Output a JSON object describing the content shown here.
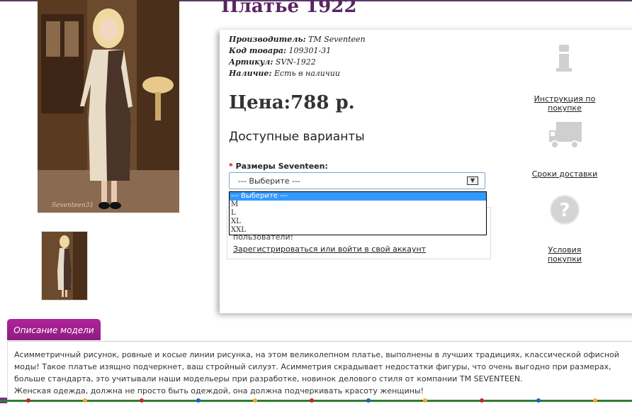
{
  "product": {
    "title": "Платье 1922",
    "meta": [
      {
        "key": "Производитель:",
        "value": " TM Seventeen"
      },
      {
        "key": "Код товара:",
        "value": " 109301-31"
      },
      {
        "key": "Артикул:",
        "value": " SVN-1922"
      },
      {
        "key": "Наличие:",
        "value": " Есть в наличии"
      }
    ],
    "price": "Цена:788 р."
  },
  "options": {
    "heading": "Доступные варианты",
    "size_label": "Размеры Seventeen:",
    "required_mark": "*",
    "selected": "--- Выберите ---",
    "items": [
      "--- Выберите ---",
      "M",
      "L",
      "XL",
      "XXL"
    ]
  },
  "login": {
    "text": "пользователи!",
    "link": "Зарегистрироваться или войти в свой аккаунт"
  },
  "side": {
    "instruction": "Инструкция по покупке",
    "delivery": "Сроки доставки",
    "conditions": "Условия покупки"
  },
  "tabs": {
    "description": "Описание модели"
  },
  "description": {
    "p1": "Асимметричный рисунок, ровные и косые линии рисунка, на этом великолепном платье, выполнены в лучших традициях, классической офисной моды! Такое платье изящно подчеркнет, ваш стройный силуэт. Асимметрия скрадывает недостатки фигуры, что очень выгодно при размерах, больше стандарта, это учитывали наши модельеры при разработке, новинок делового стиля от компании TM SEVENTEEN.",
    "p2": "Женская одежда, должна не просто быть одеждой, она должна подчеркивать красоту женщины!"
  },
  "photo": {
    "watermark": "Seventeen31"
  },
  "colors": {
    "accent": "#5a2463",
    "tab": "#9e1f8e",
    "selection": "#3399ff"
  }
}
